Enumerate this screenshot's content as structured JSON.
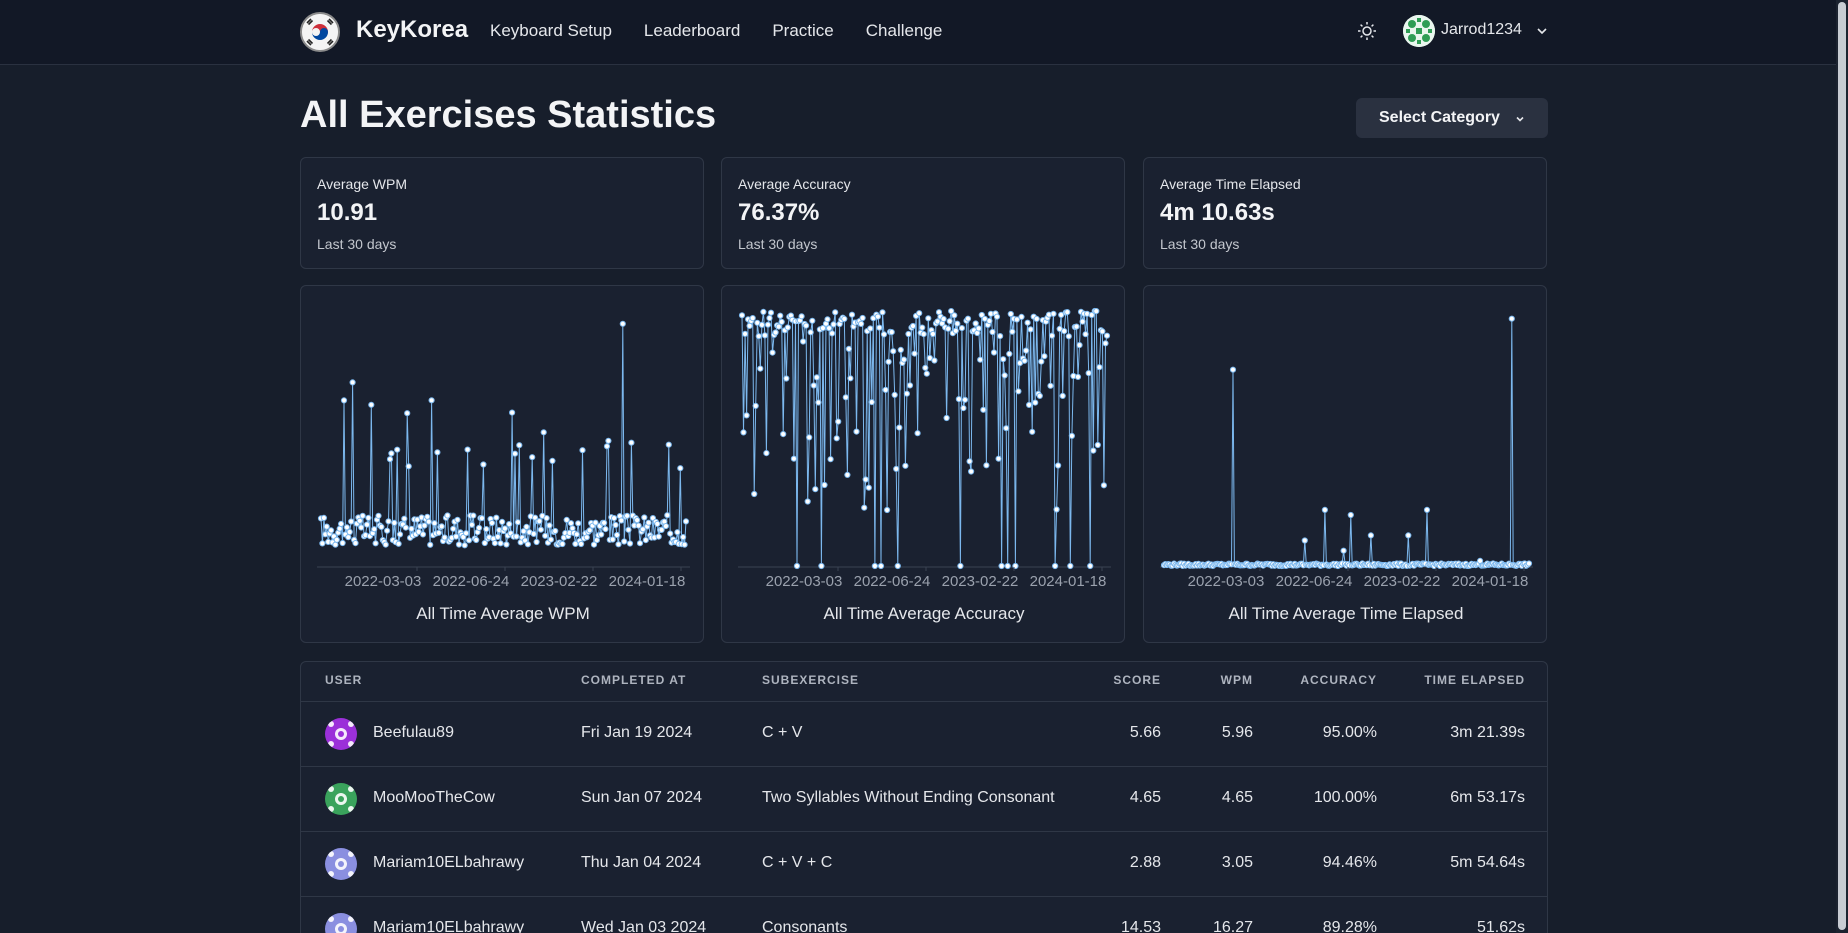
{
  "nav": {
    "brand": "KeyKorea",
    "links": [
      "Keyboard Setup",
      "Leaderboard",
      "Practice",
      "Challenge"
    ],
    "user": "Jarrod1234"
  },
  "header": {
    "title": "All Exercises Statistics",
    "category_button": "Select Category"
  },
  "stats": [
    {
      "label": "Average WPM",
      "value": "10.91",
      "sub": "Last 30 days"
    },
    {
      "label": "Average Accuracy",
      "value": "76.37%",
      "sub": "Last 30 days"
    },
    {
      "label": "Average Time Elapsed",
      "value": "4m 10.63s",
      "sub": "Last 30 days"
    }
  ],
  "chart_data": [
    {
      "type": "line",
      "title": "All Time Average WPM",
      "x_ticks": [
        "2022-03-03",
        "2022-06-24",
        "2023-02-22",
        "2024-01-18"
      ],
      "series_color": "#7cb8ee"
    },
    {
      "type": "line",
      "title": "All Time Average Accuracy",
      "x_ticks": [
        "2022-03-03",
        "2022-06-24",
        "2023-02-22",
        "2024-01-18"
      ],
      "series_color": "#7cb8ee"
    },
    {
      "type": "line",
      "title": "All Time Average Time Elapsed",
      "x_ticks": [
        "2022-03-03",
        "2022-06-24",
        "2023-02-22",
        "2024-01-18"
      ],
      "series_color": "#7cb8ee"
    }
  ],
  "table": {
    "headers": [
      "USER",
      "COMPLETED AT",
      "SUBEXERCISE",
      "SCORE",
      "WPM",
      "ACCURACY",
      "TIME ELAPSED"
    ],
    "rows": [
      {
        "user": "Beefulau89",
        "date": "Fri Jan 19 2024",
        "sub": "C + V",
        "score": "5.66",
        "wpm": "5.96",
        "acc": "95.00%",
        "time": "3m 21.39s",
        "avatar_color": "#9b30d9"
      },
      {
        "user": "MooMooTheCow",
        "date": "Sun Jan 07 2024",
        "sub": "Two Syllables Without Ending Consonant",
        "score": "4.65",
        "wpm": "4.65",
        "acc": "100.00%",
        "time": "6m 53.17s",
        "avatar_color": "#3aa35c"
      },
      {
        "user": "Mariam10ELbahrawy",
        "date": "Thu Jan 04 2024",
        "sub": "C + V + C",
        "score": "2.88",
        "wpm": "3.05",
        "acc": "94.46%",
        "time": "5m 54.64s",
        "avatar_color": "#8a8fe0"
      },
      {
        "user": "Mariam10ELbahrawy",
        "date": "Wed Jan 03 2024",
        "sub": "Consonants",
        "score": "14.53",
        "wpm": "16.27",
        "acc": "89.28%",
        "time": "51.62s",
        "avatar_color": "#8a8fe0"
      }
    ]
  }
}
